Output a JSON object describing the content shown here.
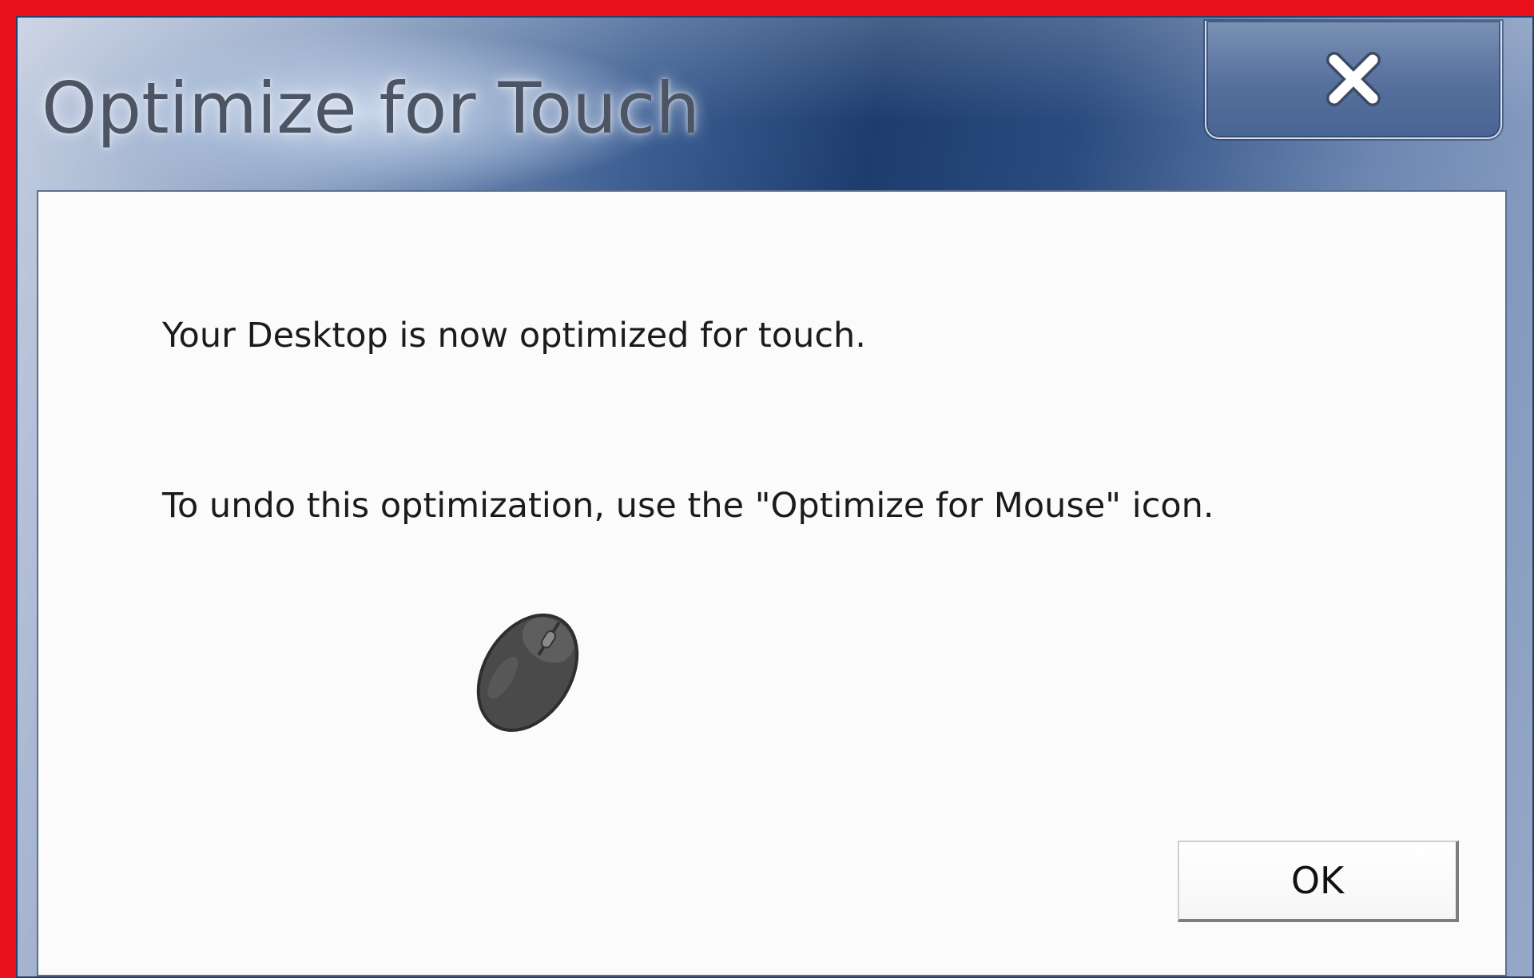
{
  "window": {
    "title": "Optimize for Touch",
    "close_icon": "close-icon"
  },
  "dialog": {
    "message_line_1": "Your Desktop is now optimized for touch.",
    "message_line_2": "To undo this optimization, use the \"Optimize for Mouse\" icon.",
    "image_icon": "mouse-icon",
    "ok_label": "OK"
  },
  "colors": {
    "frame_border": "#e8101a",
    "title_bar_dark": "#1d3d6e",
    "client_background": "#fbfbfb"
  }
}
